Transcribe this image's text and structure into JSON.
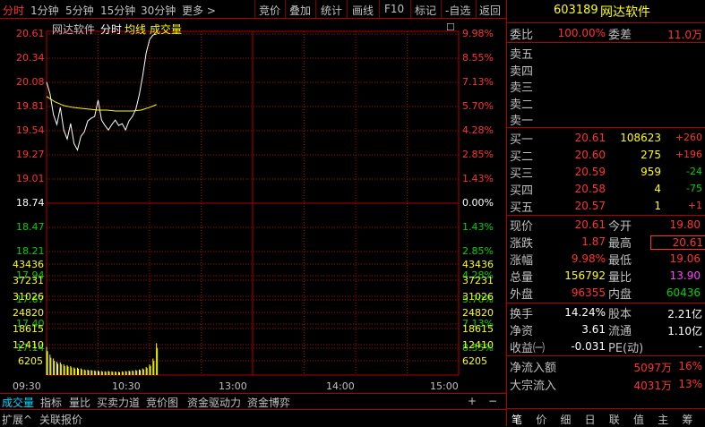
{
  "toolbar": {
    "period_tabs": [
      "分时",
      "1分钟",
      "5分钟",
      "15分钟",
      "30分钟",
      "更多 >"
    ],
    "actions": [
      "竞价",
      "叠加",
      "统计",
      "画线",
      "F10",
      "标记",
      "-自选",
      "返回"
    ]
  },
  "chart": {
    "stock_name": "网达软件",
    "mode": "分时",
    "avg_label": "均线",
    "vol_label": "成交量",
    "close_icon": "☐",
    "price_labels": [
      "20.61",
      "20.34",
      "20.08",
      "19.81",
      "19.54",
      "19.27",
      "19.01",
      "18.74",
      "18.47",
      "18.21",
      "17.94",
      "17.67",
      "17.40",
      "17.14"
    ],
    "pct_labels": [
      "9.98%",
      "8.55%",
      "7.13%",
      "5.70%",
      "4.28%",
      "2.85%",
      "1.43%",
      "0.00%",
      "1.43%",
      "2.85%",
      "4.28%",
      "5.70%",
      "7.13%",
      "8.55%"
    ],
    "vol_left_labels": [
      "43436",
      "37231",
      "31026",
      "24820",
      "18615",
      "12410",
      "6205"
    ],
    "vol_right_labels": [
      "43436",
      "37231",
      "31026",
      "24820",
      "18615",
      "12410",
      "6205"
    ],
    "time_labels": [
      "09:30",
      "10:30",
      "13:00",
      "14:00",
      "15:00"
    ],
    "colors": {
      "price_line": "#ffffff",
      "avg_line": "#ffff00",
      "grid": "#b00000",
      "volume": "#ffff00",
      "up": "#ff3232",
      "down": "#00d200"
    }
  },
  "chart_data": {
    "type": "line",
    "title": "网达软件 分时",
    "prev_close": 18.74,
    "ylim": [
      17.14,
      20.61
    ],
    "series": [
      {
        "name": "分时",
        "x": [
          0,
          2,
          4,
          6,
          8,
          10,
          12,
          14,
          16,
          18,
          20,
          22,
          24,
          26,
          28,
          30,
          32,
          34,
          36,
          38,
          40,
          42,
          44,
          46,
          48,
          50,
          52,
          54,
          56,
          58,
          60,
          62,
          64
        ],
        "values": [
          20.08,
          19.95,
          19.72,
          19.61,
          19.8,
          19.55,
          19.45,
          19.62,
          19.4,
          19.33,
          19.48,
          19.53,
          19.65,
          19.68,
          19.7,
          19.88,
          19.66,
          19.6,
          19.55,
          19.61,
          19.66,
          19.6,
          19.62,
          19.55,
          19.65,
          19.7,
          19.78,
          19.94,
          20.15,
          20.4,
          20.55,
          20.6,
          20.61
        ]
      },
      {
        "name": "均线",
        "x": [
          0,
          5,
          10,
          15,
          20,
          25,
          30,
          35,
          40,
          45,
          50,
          55,
          60,
          64
        ],
        "values": [
          19.92,
          19.86,
          19.82,
          19.8,
          19.79,
          19.78,
          19.77,
          19.77,
          19.76,
          19.76,
          19.76,
          19.77,
          19.8,
          19.83
        ]
      },
      {
        "name": "成交量",
        "x": [
          0,
          2,
          4,
          6,
          8,
          10,
          12,
          14,
          16,
          18,
          20,
          22,
          24,
          26,
          28,
          30,
          32,
          34,
          36,
          38,
          40,
          42,
          44,
          46,
          48,
          50,
          52,
          54,
          56,
          58,
          60,
          62,
          64
        ],
        "values": [
          11000,
          8000,
          6500,
          5200,
          5000,
          4200,
          3900,
          3500,
          3000,
          2900,
          2600,
          2200,
          2100,
          2000,
          1800,
          1700,
          1600,
          1500,
          1600,
          1500,
          1400,
          1300,
          1500,
          1600,
          1700,
          1800,
          2000,
          2200,
          2600,
          3200,
          4200,
          6500,
          12500
        ]
      }
    ]
  },
  "panel": {
    "code": "603189",
    "name": "网达软件",
    "weibi_label": "委比",
    "weibi_value": "100.00%",
    "weicha_label": "委差",
    "weicha_value": "11.0万",
    "sell": [
      {
        "label": "卖五",
        "price": "",
        "vol": "",
        "chg": ""
      },
      {
        "label": "卖四",
        "price": "",
        "vol": "",
        "chg": ""
      },
      {
        "label": "卖三",
        "price": "",
        "vol": "",
        "chg": ""
      },
      {
        "label": "卖二",
        "price": "",
        "vol": "",
        "chg": ""
      },
      {
        "label": "卖一",
        "price": "",
        "vol": "",
        "chg": ""
      }
    ],
    "buy": [
      {
        "label": "买一",
        "price": "20.61",
        "vol": "108623",
        "chg": "+260"
      },
      {
        "label": "买二",
        "price": "20.60",
        "vol": "275",
        "chg": "+196"
      },
      {
        "label": "买三",
        "price": "20.59",
        "vol": "959",
        "chg": "-24"
      },
      {
        "label": "买四",
        "price": "20.58",
        "vol": "4",
        "chg": "-75"
      },
      {
        "label": "买五",
        "price": "20.57",
        "vol": "1",
        "chg": "+1"
      }
    ],
    "stats": [
      {
        "l1": "现价",
        "v1": "20.61",
        "c1": "red",
        "l2": "今开",
        "v2": "19.80",
        "c2": "red"
      },
      {
        "l1": "涨跌",
        "v1": "1.87",
        "c1": "red",
        "l2": "最高",
        "v2": "20.61",
        "c2": "red"
      },
      {
        "l1": "涨幅",
        "v1": "9.98%",
        "c1": "red",
        "l2": "最低",
        "v2": "19.06",
        "c2": "red"
      },
      {
        "l1": "总量",
        "v1": "156792",
        "c1": "yellow",
        "l2": "量比",
        "v2": "13.90",
        "c2": "magenta"
      },
      {
        "l1": "外盘",
        "v1": "96355",
        "c1": "red",
        "l2": "内盘",
        "v2": "60436",
        "c2": "green"
      }
    ],
    "stats2": [
      {
        "l1": "换手",
        "v1": "14.24%",
        "l2": "股本",
        "v2": "2.21亿"
      },
      {
        "l1": "净资",
        "v1": "3.61",
        "l2": "流通",
        "v2": "1.10亿"
      },
      {
        "l1": "收益㈠",
        "v1": "-0.031",
        "l2": "PE(动)",
        "v2": "-"
      }
    ],
    "flows": [
      {
        "label": "净流入额",
        "value": "5097万",
        "pct": "16%"
      },
      {
        "label": "大宗流入",
        "value": "4031万",
        "pct": "13%"
      }
    ],
    "bottom_tabs": [
      "笔",
      "价",
      "细",
      "日",
      "联",
      "值",
      "主",
      "筹"
    ]
  },
  "bottom": {
    "tabs": [
      "成交量",
      "指标",
      "量比",
      "买卖力道",
      "竞价图",
      "资金驱动力",
      "资金博弈"
    ],
    "plus": "+",
    "minus": "−",
    "status": [
      "扩展^",
      "关联报价"
    ]
  }
}
